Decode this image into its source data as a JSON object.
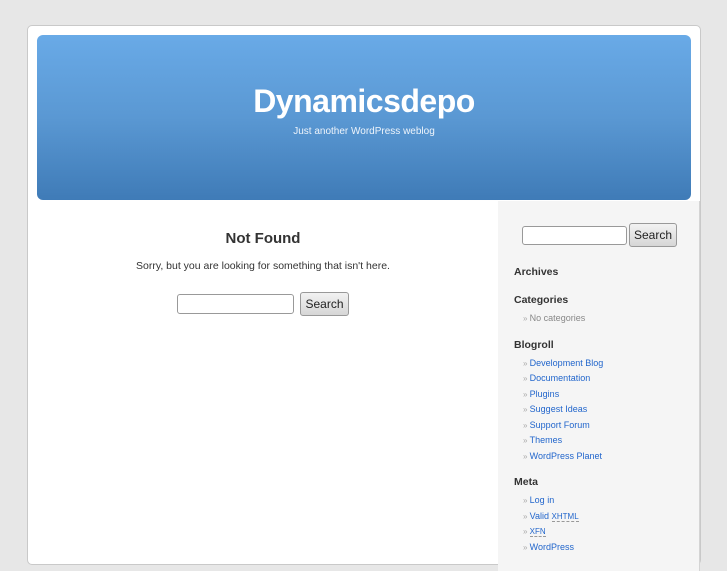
{
  "header": {
    "title": "Dynamicsdepo",
    "description": "Just another WordPress weblog"
  },
  "content": {
    "title": "Not Found",
    "message": "Sorry, but you are looking for something that isn't here.",
    "search_button": "Search"
  },
  "sidebar": {
    "search_button": "Search",
    "archives_title": "Archives",
    "categories_title": "Categories",
    "categories": [
      "No categories"
    ],
    "blogroll_title": "Blogroll",
    "blogroll": [
      "Development Blog",
      "Documentation",
      "Plugins",
      "Suggest Ideas",
      "Support Forum",
      "Themes",
      "WordPress Planet"
    ],
    "meta_title": "Meta",
    "meta": {
      "login": "Log in",
      "valid": "Valid",
      "xhtml": "XHTML",
      "xfn": "XFN",
      "wordpress": "WordPress"
    }
  }
}
